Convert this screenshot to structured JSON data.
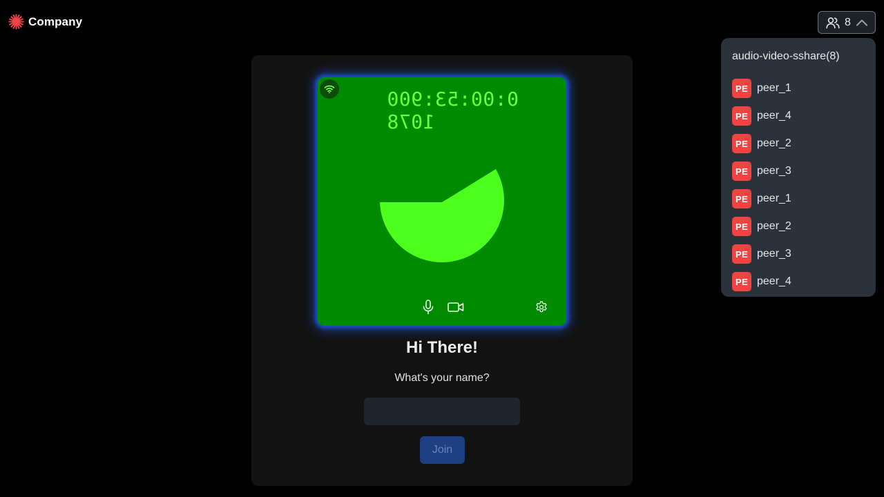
{
  "brand": {
    "name": "Company",
    "accent": "#ef4444"
  },
  "header": {
    "peer_count": "8",
    "people_icon": "people-icon",
    "toggle_icon": "chevron-up-icon"
  },
  "peer_panel": {
    "room_title": "audio-video-sshare(8)",
    "peers": [
      {
        "initials": "PE",
        "name": "peer_1"
      },
      {
        "initials": "PE",
        "name": "peer_4"
      },
      {
        "initials": "PE",
        "name": "peer_2"
      },
      {
        "initials": "PE",
        "name": "peer_3"
      },
      {
        "initials": "PE",
        "name": "peer_1"
      },
      {
        "initials": "PE",
        "name": "peer_2"
      },
      {
        "initials": "PE",
        "name": "peer_3"
      },
      {
        "initials": "PE",
        "name": "peer_4"
      }
    ],
    "avatar_color": "#ef4444"
  },
  "preview": {
    "timer_text": "0:00:53:900 1078",
    "background_color": "#008a00",
    "shape_color": "#4cff1c",
    "controls": [
      "wifi-icon",
      "microphone-icon",
      "video-camera-icon",
      "gear-icon"
    ]
  },
  "join_form": {
    "greeting": "Hi There!",
    "prompt": "What's your name?",
    "name_value": "",
    "name_placeholder": "",
    "join_label": "Join"
  }
}
